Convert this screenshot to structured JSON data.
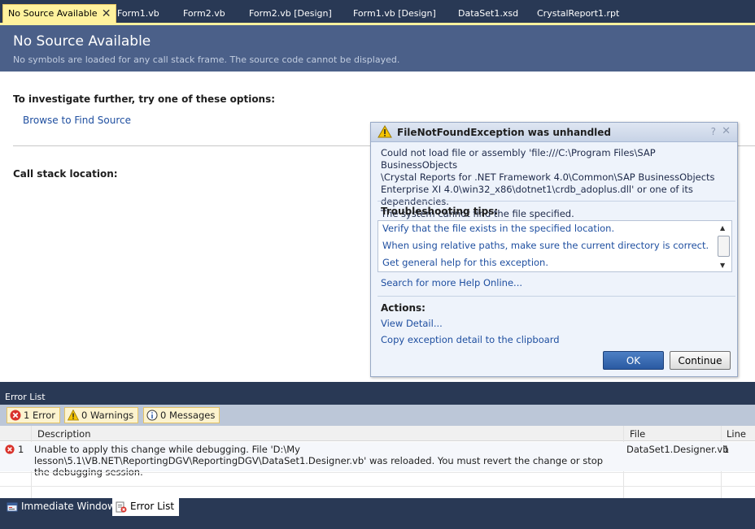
{
  "tabs": [
    {
      "label": "No Source Available",
      "active": true
    },
    {
      "label": "Form1.vb"
    },
    {
      "label": "Form2.vb"
    },
    {
      "label": "Form2.vb [Design]"
    },
    {
      "label": "Form1.vb [Design]"
    },
    {
      "label": "DataSet1.xsd"
    },
    {
      "label": "CrystalReport1.rpt"
    }
  ],
  "tab_close_glyph": "✕",
  "source_page": {
    "title": "No Source Available",
    "subtitle": "No symbols are loaded for any call stack frame. The source code cannot be displayed.",
    "investigate_label": "To investigate further, try one of these options:",
    "browse_link": "Browse to Find Source",
    "call_stack_label": "Call stack location:"
  },
  "exception_dialog": {
    "title": "FileNotFoundException was unhandled",
    "help_glyph": "?",
    "close_glyph": "✕",
    "message_lines": [
      "Could not load file or assembly 'file:///C:\\Program Files\\SAP BusinessObjects",
      "\\Crystal Reports for .NET Framework 4.0\\Common\\SAP BusinessObjects",
      "Enterprise XI 4.0\\win32_x86\\dotnet1\\crdb_adoplus.dll' or one of its dependencies.",
      "The system cannot find the file specified."
    ],
    "tips_label": "Troubleshooting tips:",
    "tips": [
      "Verify that the file exists in the specified location.",
      "When using relative paths, make sure the current directory is correct.",
      "Get general help for this exception."
    ],
    "search_help": "Search for more Help Online...",
    "actions_label": "Actions:",
    "actions": [
      "View Detail...",
      "Copy exception detail to the clipboard"
    ],
    "ok_label": "OK",
    "continue_label": "Continue",
    "accent_color": "#2a5aa2"
  },
  "error_list": {
    "title": "Error List",
    "errors_btn": "1 Error",
    "warnings_btn": "0 Warnings",
    "messages_btn": "0 Messages",
    "columns": {
      "description": "Description",
      "file": "File",
      "line": "Line"
    },
    "rows": [
      {
        "num": "1",
        "description": "Unable to apply this change while debugging. File 'D:\\My lesson\\5.1\\VB.NET\\ReportingDGV\\ReportingDGV\\DataSet1.Designer.vb' was reloaded. You must revert the change or stop the debugging session.",
        "file": "DataSet1.Designer.vb",
        "line": "1"
      }
    ]
  },
  "bottom_tabs": [
    {
      "label": "Immediate Window"
    },
    {
      "label": "Error List",
      "active": true
    }
  ],
  "colors": {
    "chrome": "#293955",
    "header": "#4b6089",
    "active_tab": "#fff29d",
    "link": "#1f4fa0",
    "error_red": "#d9322b",
    "warning_yellow": "#f5c400"
  }
}
